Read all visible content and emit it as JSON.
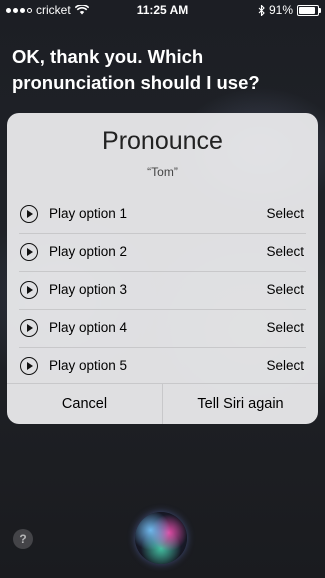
{
  "status": {
    "carrier": "cricket",
    "time": "11:25 AM",
    "battery": "91%",
    "battery_level": 0.91
  },
  "siri": {
    "response": "OK, thank you. Which pronunciation should I use?"
  },
  "card": {
    "title": "Pronounce",
    "subtitle": "“Tom”",
    "options": [
      {
        "label": "Play option 1",
        "select": "Select"
      },
      {
        "label": "Play option 2",
        "select": "Select"
      },
      {
        "label": "Play option 3",
        "select": "Select"
      },
      {
        "label": "Play option 4",
        "select": "Select"
      },
      {
        "label": "Play option 5",
        "select": "Select"
      }
    ],
    "cancel": "Cancel",
    "tell_again": "Tell Siri again"
  },
  "help": "?"
}
